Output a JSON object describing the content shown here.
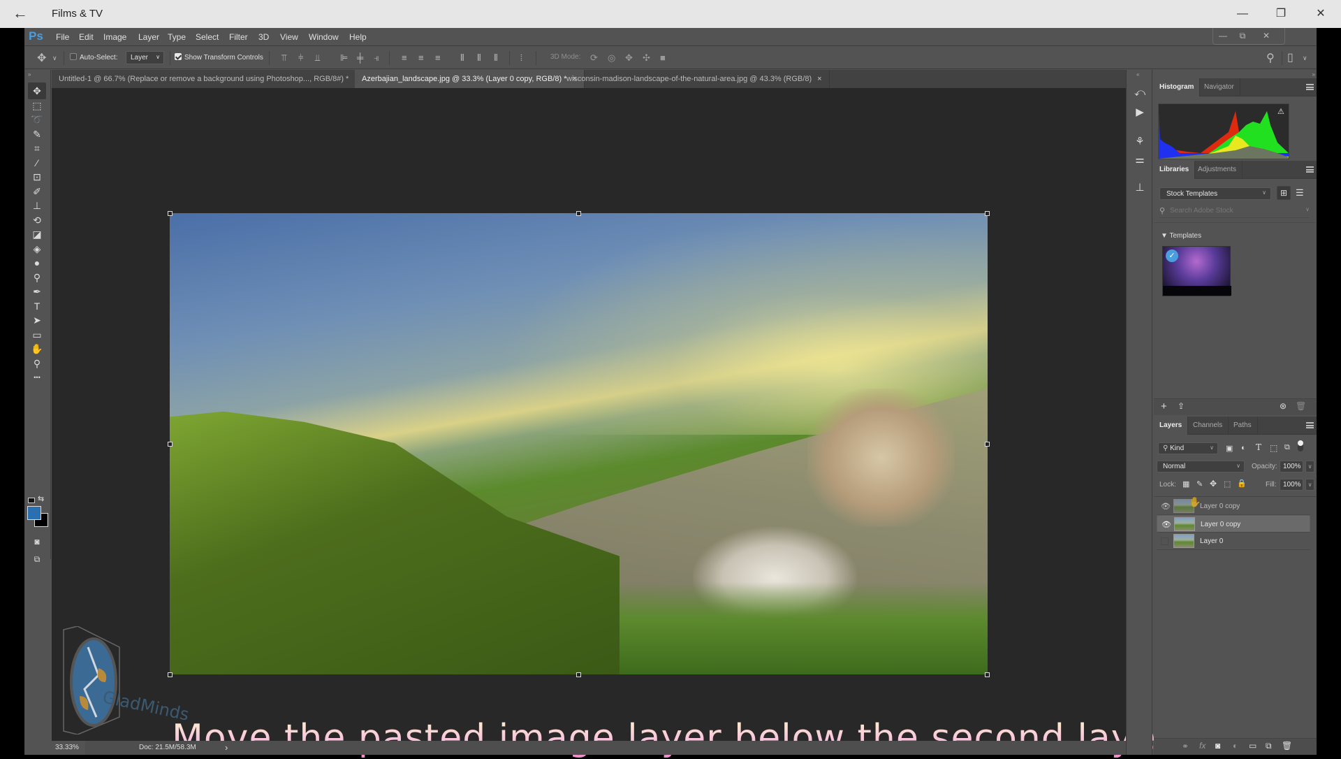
{
  "window": {
    "title": "Films & TV",
    "back_icon": "←",
    "controls": {
      "minimize": "—",
      "restore": "❐",
      "close": "✕"
    }
  },
  "app": {
    "logo": "Ps",
    "menu": [
      "File",
      "Edit",
      "Image",
      "Layer",
      "Type",
      "Select",
      "Filter",
      "3D",
      "View",
      "Window",
      "Help"
    ],
    "doc_controls": {
      "minimize": "—",
      "restore": "⧉",
      "close": "✕"
    }
  },
  "options_bar": {
    "move_tool_icon": "✥",
    "auto_select_label": "Auto-Select:",
    "auto_select_checked": false,
    "auto_select_target": "Layer",
    "show_transform_label": "Show Transform Controls",
    "show_transform_checked": true,
    "mode_3d_label": "3D Mode:",
    "search_icon": "⚲",
    "workspace_icon": "▯"
  },
  "tabs": [
    {
      "label": "Untitled-1 @ 66.7% (Replace or remove a  background using Photoshop..., RGB/8#) *",
      "active": false
    },
    {
      "label": "Azerbajian_landscape.jpg @ 33.3% (Layer 0 copy, RGB/8) *",
      "active": true
    },
    {
      "label": "wisconsin-madison-landscape-of-the-natural-area.jpg @ 43.3% (RGB/8)",
      "active": false
    }
  ],
  "tab_close": "×",
  "tools": [
    {
      "name": "move-tool",
      "glyph": "✥",
      "active": true
    },
    {
      "name": "marquee-tool",
      "glyph": "⬚"
    },
    {
      "name": "lasso-tool",
      "glyph": "➰"
    },
    {
      "name": "quick-selection-tool",
      "glyph": "✎"
    },
    {
      "name": "crop-tool",
      "glyph": "⌗"
    },
    {
      "name": "eyedropper-tool",
      "glyph": "⁄"
    },
    {
      "name": "healing-brush-tool",
      "glyph": "⊡"
    },
    {
      "name": "brush-tool",
      "glyph": "✐"
    },
    {
      "name": "clone-stamp-tool",
      "glyph": "⊥"
    },
    {
      "name": "history-brush-tool",
      "glyph": "⟲"
    },
    {
      "name": "eraser-tool",
      "glyph": "◪"
    },
    {
      "name": "paint-bucket-tool",
      "glyph": "◈"
    },
    {
      "name": "blur-tool",
      "glyph": "●"
    },
    {
      "name": "dodge-tool",
      "glyph": "⚲"
    },
    {
      "name": "pen-tool",
      "glyph": "✒"
    },
    {
      "name": "type-tool",
      "glyph": "T"
    },
    {
      "name": "path-selection-tool",
      "glyph": "➤"
    },
    {
      "name": "rectangle-tool",
      "glyph": "▭"
    },
    {
      "name": "hand-tool",
      "glyph": "✋"
    },
    {
      "name": "zoom-tool",
      "glyph": "⚲"
    },
    {
      "name": "more-tools",
      "glyph": "•••"
    }
  ],
  "colors": {
    "foreground": "#2a6fb0",
    "background": "#000000",
    "accent": "#4a9ee0",
    "caption_top": "#fff6c8",
    "caption_bottom": "#ee88c8"
  },
  "canvas": {
    "watermark_text": "GladMinds",
    "caption": "Move the pasted image layer below the second layer"
  },
  "status": {
    "zoom": "33.33%",
    "doc": "Doc: 21.5M/58.3M",
    "arrow": "›"
  },
  "panels": {
    "histogram_tabs": [
      "Histogram",
      "Navigator"
    ],
    "histogram_warning_icon": "⚠",
    "libraries_tabs": [
      "Libraries",
      "Adjustments"
    ],
    "library_select": "Stock Templates",
    "search_placeholder": "Search Adobe Stock",
    "templates_header": "▼ Templates",
    "layers_tabs": [
      "Layers",
      "Channels",
      "Paths"
    ],
    "filter_kind": "Kind",
    "blend_mode": "Normal",
    "opacity_label": "Opacity:",
    "opacity_value": "100%",
    "lock_label": "Lock:",
    "fill_label": "Fill:",
    "fill_value": "100%",
    "layers": [
      {
        "name": "Layer 0 copy",
        "visible": true,
        "selected": false,
        "dragging": true
      },
      {
        "name": "Layer 0 copy",
        "visible": true,
        "selected": true,
        "dragging": false
      },
      {
        "name": "Layer 0",
        "visible": false,
        "selected": false,
        "dragging": false
      }
    ]
  }
}
